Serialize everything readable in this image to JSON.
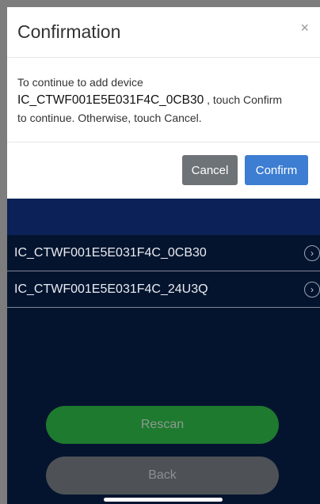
{
  "dialog": {
    "title": "Confirmation",
    "close_icon": "×",
    "message_line1": "To continue to add device",
    "device_id": "IC_CTWF001E5E031F4C_0CB30",
    "message_line2_suffix": ", touch Confirm",
    "message_line3": "to continue. Otherwise, touch Cancel.",
    "cancel_label": "Cancel",
    "confirm_label": "Confirm"
  },
  "devices": [
    {
      "label": "IC_CTWF001E5E031F4C_0CB30",
      "icon": "chevron-right-circle-icon"
    },
    {
      "label": "IC_CTWF001E5E031F4C_24U3Q",
      "icon": "chevron-right-circle-icon"
    }
  ],
  "actions": {
    "rescan_label": "Rescan",
    "back_label": "Back"
  },
  "colors": {
    "app_background": "#05142e",
    "header_bar": "#0c2157",
    "confirm_button": "#3d7dd2",
    "cancel_button": "#6e7378",
    "rescan_button": "#1e7a2f",
    "back_button": "#4e5257"
  }
}
